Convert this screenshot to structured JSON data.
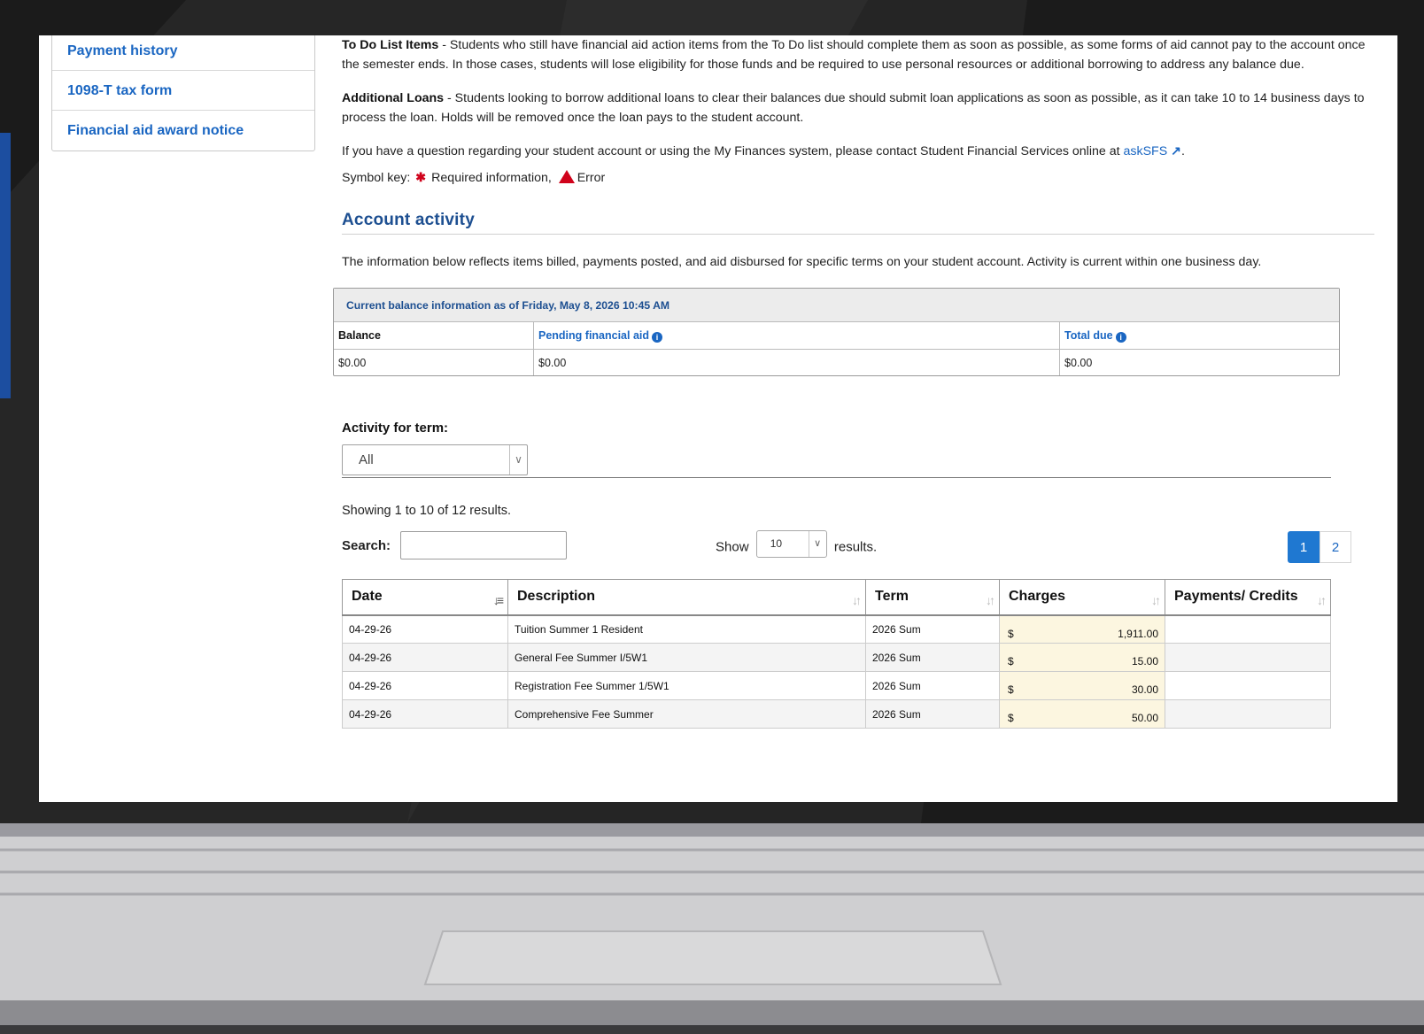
{
  "sidebar": {
    "items": [
      {
        "label": "Payment history"
      },
      {
        "label": "1098-T tax form"
      },
      {
        "label": "Financial aid award notice"
      }
    ]
  },
  "intro": {
    "todo_title": "To Do List Items",
    "todo_text": " - Students who still have financial aid action items from the To Do list should complete them as soon as possible, as some forms of aid cannot pay to the account once the semester ends.  In those cases, students will lose eligibility for those funds and be required to use personal resources or additional borrowing to address any balance due.",
    "loans_title": "Additional Loans",
    "loans_text": " - Students looking to borrow additional loans to clear their balances due should submit loan applications as soon as possible, as it can take 10 to 14 business days to process the loan.  Holds will be removed once the loan pays to the student account.",
    "question_text": "If you have a question regarding your student account or using the My Finances system, please contact Student Financial Services online at ",
    "question_link": "askSFS",
    "symbol_key": "Symbol key:",
    "required_label": "Required information,",
    "error_label": "Error"
  },
  "account_activity": {
    "heading": "Account activity",
    "description": "The information below reflects items billed, payments posted, and aid disbursed for specific terms on your student account. Activity is current within one business day."
  },
  "balance": {
    "caption": "Current balance information as of Friday, May 8, 2026 10:45 AM",
    "headers": [
      "Balance",
      "Pending financial aid",
      "Total due"
    ],
    "values": [
      "$0.00",
      "$0.00",
      "$0.00"
    ]
  },
  "term_filter": {
    "label": "Activity for term:",
    "selected": "All"
  },
  "results": {
    "showing": "Showing 1 to 10 of 12 results.",
    "search_label": "Search:",
    "show_label": "Show",
    "show_value": "10",
    "results_label": "results.",
    "pages": [
      "1",
      "2"
    ]
  },
  "table": {
    "headers": [
      "Date",
      "Description",
      "Term",
      "Charges",
      "Payments/ Credits"
    ],
    "rows": [
      {
        "date": "04-29-26",
        "description": "Tuition Summer 1 Resident",
        "term": "2026 Sum",
        "currency": "$",
        "charges": "1,911.00",
        "credits": ""
      },
      {
        "date": "04-29-26",
        "description": "General Fee Summer I/5W1",
        "term": "2026 Sum",
        "currency": "$",
        "charges": "15.00",
        "credits": ""
      },
      {
        "date": "04-29-26",
        "description": "Registration Fee Summer 1/5W1",
        "term": "2026 Sum",
        "currency": "$",
        "charges": "30.00",
        "credits": ""
      },
      {
        "date": "04-29-26",
        "description": "Comprehensive Fee Summer",
        "term": "2026 Sum",
        "currency": "$",
        "charges": "50.00",
        "credits": ""
      }
    ]
  },
  "colors": {
    "link": "#1a66c2",
    "heading": "#1d4f91",
    "required": "#d0021b",
    "pager_active": "#1f78d1",
    "charge_cell": "#fcf6e0",
    "laptop_frame": "#1c1c1c"
  }
}
